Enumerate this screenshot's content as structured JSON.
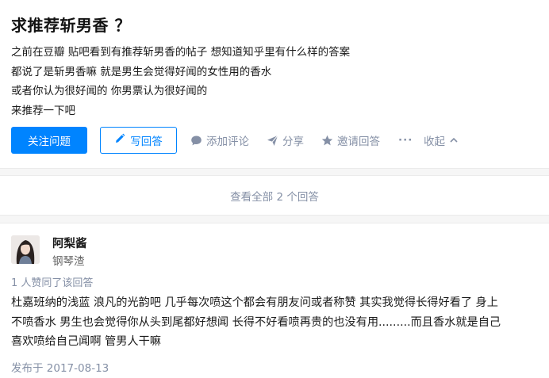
{
  "question": {
    "title": "求推荐斩男香 ？",
    "body_lines": [
      "之前在豆瓣 贴吧看到有推荐斩男香的帖子  想知道知乎里有什么样的答案",
      "都说了是斩男香嘛 就是男生会觉得好闻的女性用的香水",
      "或者你认为很好闻的 你男票认为很好闻的",
      "来推荐一下吧"
    ]
  },
  "actions": {
    "follow_label": "关注问题",
    "write_answer_label": "写回答",
    "comment_label": "添加评论",
    "share_label": "分享",
    "invite_label": "邀请回答",
    "more_label": "···",
    "collapse_label": "收起"
  },
  "view_all": {
    "label": "查看全部 2 个回答"
  },
  "answer": {
    "author_name": "阿梨酱",
    "author_bio": "钢琴渣",
    "vote_info": "1 人赞同了该回答",
    "text_lines": [
      "杜嘉班纳的浅蓝 浪凡的光韵吧 几乎每次喷这个都会有朋友问或者称赞 其实我觉得长得好看了 身上",
      "不喷香水 男生也会觉得你从头到尾都好想闻 长得不好看喷再贵的也没有用.........而且香水就是自己",
      "喜欢喷给自己闻啊 管男人干嘛"
    ],
    "publish_date": "发布于 2017-08-13"
  },
  "colors": {
    "accent": "#0084ff",
    "muted": "#8590a6",
    "background": "#f6f6f6"
  },
  "icons": {
    "pen": "pen-icon",
    "comment": "comment-bubble-icon",
    "share": "paper-plane-icon",
    "invite": "star-icon",
    "collapse": "chevron-up-icon"
  }
}
